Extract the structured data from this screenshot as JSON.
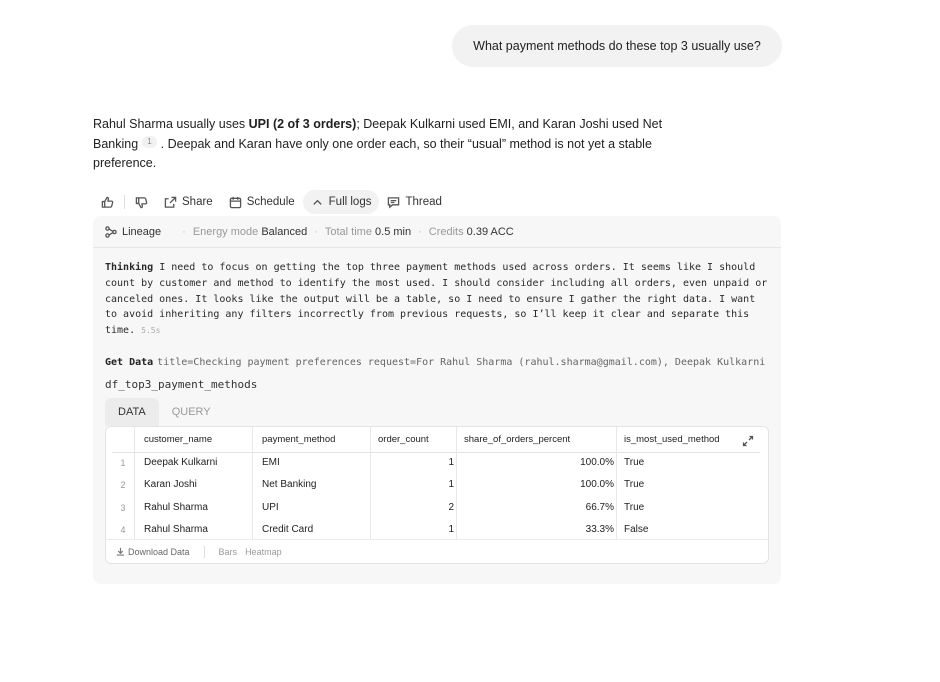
{
  "user_message": "What payment methods do these top 3 usually use?",
  "answer": {
    "part1": "Rahul Sharma usually uses ",
    "bold": "UPI (2 of 3 orders)",
    "part2": "; Deepak Kulkarni used EMI, and Karan Joshi used Net Banking",
    "citation": "1",
    "part3": ". Deepak and Karan have only one order each, so their “usual” method is not yet a stable preference."
  },
  "actions": {
    "share": "Share",
    "schedule": "Schedule",
    "full_logs": "Full logs",
    "thread": "Thread"
  },
  "meta": {
    "lineage": "Lineage",
    "energy_label": "Energy mode",
    "energy_value": "Balanced",
    "time_label": "Total time",
    "time_value": "0.5 min",
    "credits_label": "Credits",
    "credits_value": "0.39 ACC"
  },
  "thinking": {
    "label": "Thinking",
    "text": " I need to focus on getting the top three payment methods used across orders. It seems like I should count by customer and method to identify the most used. I should consider including all orders, even unpaid or canceled ones. It looks like the output will be a table, so I need to ensure I gather the right data. I want to avoid inheriting any filters incorrectly from previous requests, so I’ll keep it clear and separate this time.",
    "duration": "5.5s"
  },
  "get_data": {
    "label": "Get Data",
    "text": "title=Checking payment preferences request=For Rahul Sharma (rahul.sharma@gmail.com), Deepak Kulkarni (…",
    "chevron": "›"
  },
  "dataframe": {
    "name": "df_top3_payment_methods",
    "tabs": [
      "DATA",
      "QUERY"
    ],
    "columns": [
      "customer_name",
      "payment_method",
      "order_count",
      "share_of_orders_percent",
      "is_most_used_method"
    ],
    "rows": [
      {
        "idx": "1",
        "customer_name": "Deepak Kulkarni",
        "payment_method": "EMI",
        "order_count": "1",
        "share": "100.0%",
        "most_used": "True"
      },
      {
        "idx": "2",
        "customer_name": "Karan Joshi",
        "payment_method": "Net Banking",
        "order_count": "1",
        "share": "100.0%",
        "most_used": "True"
      },
      {
        "idx": "3",
        "customer_name": "Rahul Sharma",
        "payment_method": "UPI",
        "order_count": "2",
        "share": "66.7%",
        "most_used": "True"
      },
      {
        "idx": "4",
        "customer_name": "Rahul Sharma",
        "payment_method": "Credit Card",
        "order_count": "1",
        "share": "33.3%",
        "most_used": "False"
      }
    ],
    "footer": {
      "download": "Download Data",
      "bars": "Bars",
      "heatmap": "Heatmap"
    }
  }
}
